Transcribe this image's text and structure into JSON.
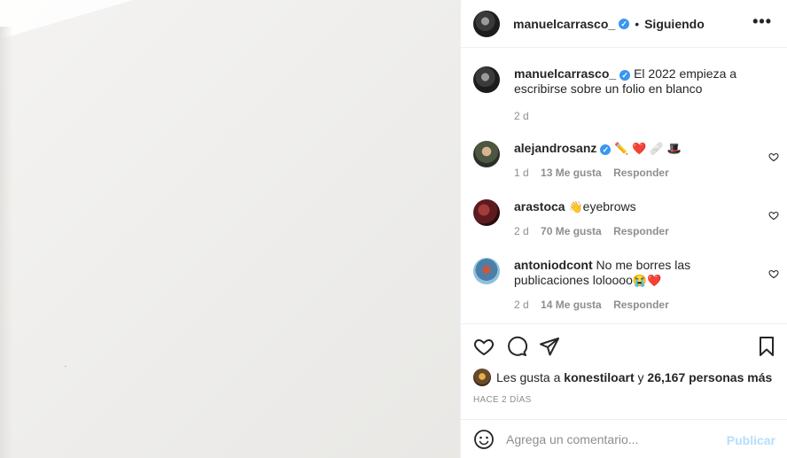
{
  "post": {
    "author": "manuelcarrasco_",
    "verified_mark": "✓",
    "separator": "•",
    "follow_status": "Siguiendo",
    "more_icon": "•••",
    "caption": "El 2022 empieza a escribirse sobre un folio en blanco",
    "caption_time": "2 d"
  },
  "comments": [
    {
      "user": "alejandrosanz",
      "verified": true,
      "text": "",
      "emojis": "✏️ ❤️ 🩹 🎩",
      "time": "1 d",
      "likes": "13 Me gusta",
      "reply": "Responder"
    },
    {
      "user": "arastoca",
      "verified": false,
      "text": "eyebrows",
      "emojis": "👋",
      "time": "2 d",
      "likes": "70 Me gusta",
      "reply": "Responder"
    },
    {
      "user": "antoniodcont",
      "verified": false,
      "text": "No me borres las publicaciones loloooo",
      "emojis": "😭❤️",
      "time": "2 d",
      "likes": "14 Me gusta",
      "reply": "Responder"
    }
  ],
  "likes": {
    "prefix": "Les gusta a",
    "user": "konestiloart",
    "joiner": "y",
    "others": "26,167 personas más"
  },
  "date": "HACE 2 DÍAS",
  "composer": {
    "placeholder": "Agrega un comentario...",
    "post_label": "Publicar"
  },
  "colors": {
    "verified": "#3897f0",
    "post_disabled": "#b2dffc",
    "meta": "#8e8e8e",
    "text": "#262626"
  }
}
